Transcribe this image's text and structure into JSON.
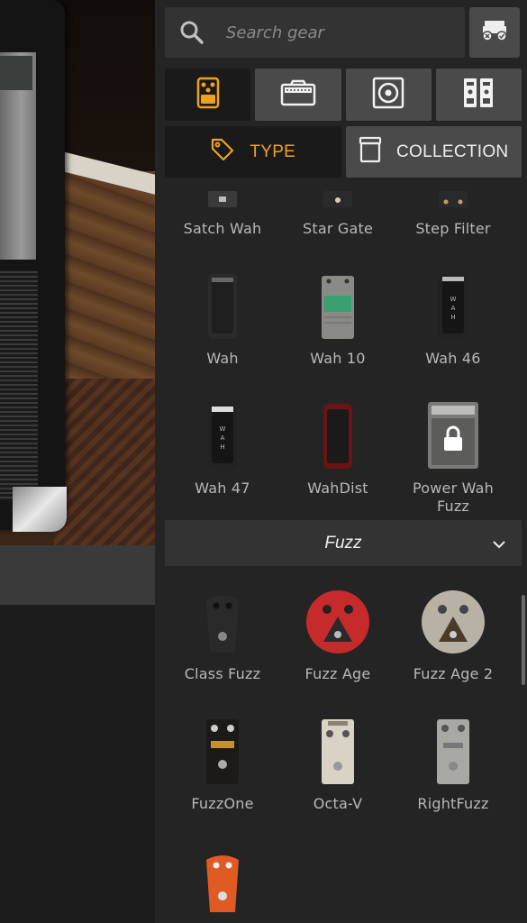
{
  "search": {
    "placeholder": "Search gear"
  },
  "category_buttons": [
    {
      "id": "stompbox",
      "icon": "stompbox-icon",
      "active": true
    },
    {
      "id": "amp",
      "icon": "amp-icon",
      "active": false
    },
    {
      "id": "cab",
      "icon": "cab-icon",
      "active": false
    },
    {
      "id": "rack",
      "icon": "rack-icon",
      "active": false
    }
  ],
  "sort": {
    "type_label": "TYPE",
    "collection_label": "COLLECTION"
  },
  "colors": {
    "accent": "#f0a020",
    "panel": "#242424",
    "button": "#4a4a4a",
    "active_button": "#1a1a1a"
  },
  "wah_group": {
    "items": [
      "Satch Wah",
      "Star Gate",
      "Step Filter",
      "Wah",
      "Wah 10",
      "Wah 46",
      "Wah 47",
      "WahDist",
      "Power Wah Fuzz"
    ],
    "locked": [
      false,
      false,
      false,
      false,
      false,
      false,
      false,
      false,
      true
    ]
  },
  "fuzz_group": {
    "title": "Fuzz",
    "items": [
      "Class Fuzz",
      "Fuzz Age",
      "Fuzz Age 2",
      "FuzzOne",
      "Octa-V",
      "RightFuzz",
      ""
    ]
  }
}
